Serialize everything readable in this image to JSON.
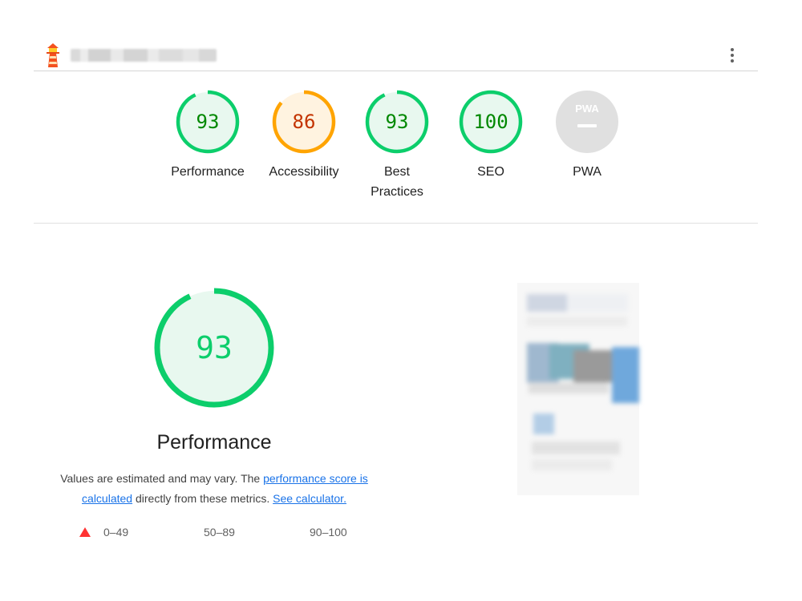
{
  "header": {
    "logo_icon": "lighthouse-icon",
    "menu_icon": "vertical-dots-icon"
  },
  "categories": [
    {
      "label": "Performance",
      "score": 93,
      "status": "pass",
      "color": "#0cce6b"
    },
    {
      "label": "Accessibility",
      "score": 86,
      "status": "average",
      "color": "#ffa400"
    },
    {
      "label": "Best Practices",
      "score": 93,
      "status": "pass",
      "color": "#0cce6b"
    },
    {
      "label": "SEO",
      "score": 100,
      "status": "pass",
      "color": "#0cce6b"
    },
    {
      "label": "PWA",
      "score": null,
      "badge_text": "PWA",
      "status": "not-applicable",
      "color": "#e0e0e0"
    }
  ],
  "performance": {
    "score": 93,
    "title": "Performance",
    "description_prefix": "Values are estimated and may vary. The ",
    "score_link": "performance score is calculated",
    "description_middle": " directly from these metrics. ",
    "calculator_link": "See calculator.",
    "color": "#0cce6b"
  },
  "legend": {
    "fail": "0–49",
    "average": "50–89",
    "pass": "90–100"
  },
  "colors": {
    "pass": "#0cce6b",
    "pass_text": "#008800",
    "pass_fill": "#e8f8ef",
    "average": "#ffa400",
    "average_text": "#c33300",
    "average_fill": "#fff3e0",
    "fail": "#ff3333",
    "link": "#1a73e8"
  }
}
